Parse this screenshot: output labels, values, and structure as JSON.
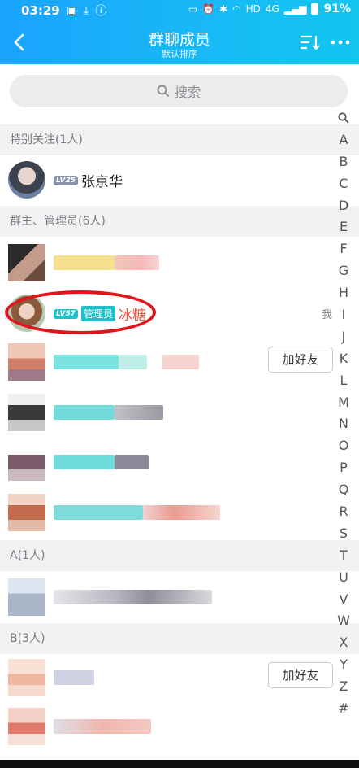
{
  "status_bar": {
    "time": "03:29",
    "network": "HD",
    "signal": "4G",
    "battery": "91%"
  },
  "header": {
    "title": "群聊成员",
    "subtitle": "默认排序",
    "back_icon": "back-arrow-icon",
    "sort_icon": "sort-icon",
    "more_icon": "more-dots-icon"
  },
  "search": {
    "placeholder": "搜索"
  },
  "sections": {
    "special": "特别关注(1人)",
    "admins": "群主、管理员(6人)",
    "a": "A(1人)",
    "b": "B(3人)"
  },
  "members": {
    "special_1": {
      "level": "LV25",
      "name": "张京华"
    },
    "admin_2": {
      "level": "LV57",
      "badge": "管理员",
      "name": "冰糖",
      "me": "我"
    }
  },
  "buttons": {
    "add_friend": "加好友"
  },
  "index_letters": [
    "A",
    "B",
    "C",
    "D",
    "E",
    "F",
    "G",
    "H",
    "I",
    "J",
    "K",
    "L",
    "M",
    "N",
    "O",
    "P",
    "Q",
    "R",
    "S",
    "T",
    "U",
    "V",
    "W",
    "X",
    "Y",
    "Z",
    "#"
  ],
  "colors": {
    "header_start": "#1aa3ff",
    "header_end": "#12c6f0",
    "highlight_circle": "#e1141c",
    "admin_name": "#f2523d"
  }
}
